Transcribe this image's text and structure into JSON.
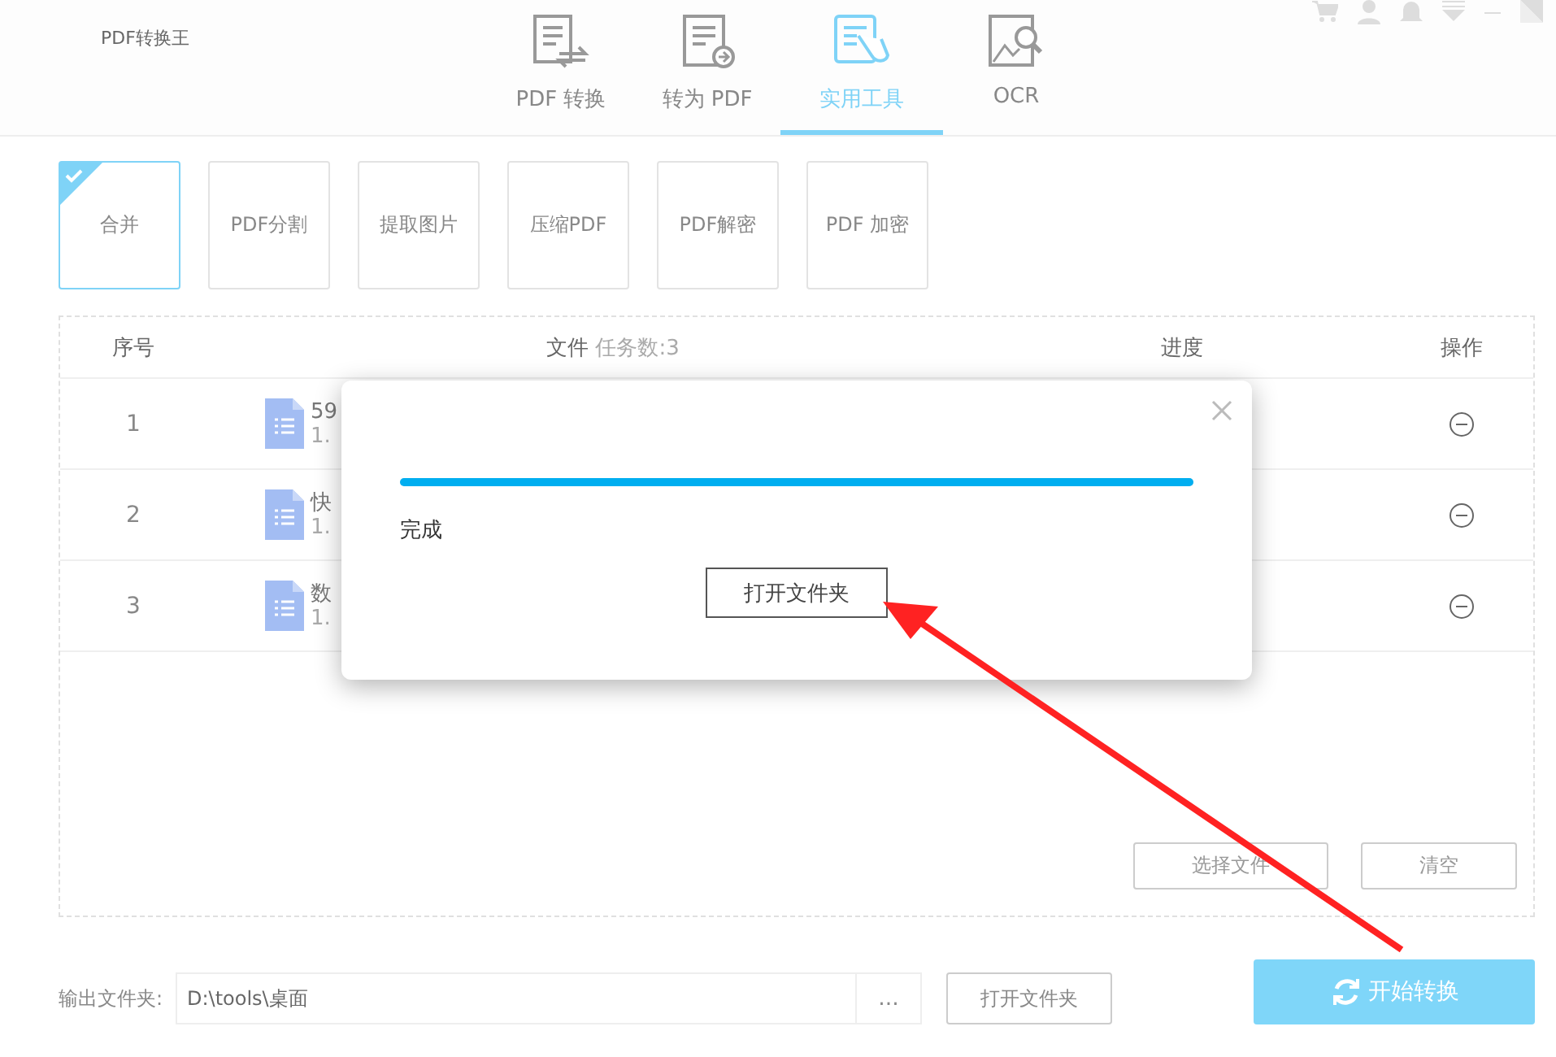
{
  "window": {
    "title": "PDF转换王"
  },
  "nav_tabs": [
    {
      "label": "PDF 转换",
      "kind": "convert",
      "selected": false
    },
    {
      "label": "转为 PDF",
      "kind": "to-pdf",
      "selected": false
    },
    {
      "label": "实用工具",
      "kind": "tools",
      "selected": true
    },
    {
      "label": "OCR",
      "kind": "ocr",
      "selected": false
    }
  ],
  "tools": [
    {
      "label": "合并",
      "selected": true
    },
    {
      "label": "PDF分割",
      "selected": false
    },
    {
      "label": "提取图片",
      "selected": false
    },
    {
      "label": "压缩PDF",
      "selected": false
    },
    {
      "label": "PDF解密",
      "selected": false
    },
    {
      "label": "PDF 加密",
      "selected": false
    }
  ],
  "table": {
    "columns": [
      "序号",
      "文件",
      "进度",
      "操作"
    ],
    "task_count": "任务数:3",
    "rows": [
      {
        "index": "1",
        "name": "59",
        "size": "1."
      },
      {
        "index": "2",
        "name": "快",
        "size": "1."
      },
      {
        "index": "3",
        "name": "数",
        "size": "1."
      }
    ]
  },
  "list_buttons": [
    "选择文件",
    "清空"
  ],
  "output": {
    "label": "输出文件夹:",
    "value": "D:\\tools\\桌面",
    "browse": "...",
    "open_button": "打开文件夹"
  },
  "start_button": "开始转换",
  "dialog": {
    "level": 1,
    "status": "完成",
    "button": "打开文件夹"
  }
}
